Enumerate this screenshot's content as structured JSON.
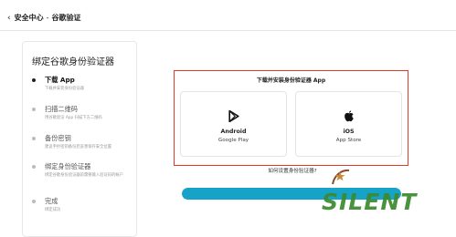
{
  "breadcrumb": {
    "back_icon": "chevron-left-icon",
    "parent": "安全中心",
    "separator": "-",
    "current": "谷歌验证"
  },
  "steps_panel": {
    "title": "绑定谷歌身份验证器",
    "active_index": 0,
    "steps": [
      {
        "name": "下载 App",
        "desc": "下载并安装身份验证器"
      },
      {
        "name": "扫描二维码",
        "desc": "用谷歌验证 App 扫描下方二维码"
      },
      {
        "name": "备份密钥",
        "desc": "建议手抄密钥备份后妥善保存安全位置"
      },
      {
        "name": "绑定身份验证器",
        "desc": "绑定谷歌身份验证器前需要输入验证码的帐户"
      },
      {
        "name": "完成",
        "desc": "绑定成功"
      }
    ]
  },
  "download": {
    "title": "下载并安装身份验证器 App",
    "stores": [
      {
        "platform": "Android",
        "store": "Google Play",
        "icon": "google-play-icon"
      },
      {
        "platform": "iOS",
        "store": "App Store",
        "icon": "apple-icon"
      }
    ],
    "help_link": "如何设置身份验证器?"
  },
  "progress": {
    "fraction": 1.0
  },
  "watermark": {
    "text": "SILENT"
  },
  "colors": {
    "highlight": "#e33a2a",
    "progress": "#17a2c8",
    "progress_track": "#d3eef6",
    "watermark": "#3a8a2e"
  }
}
